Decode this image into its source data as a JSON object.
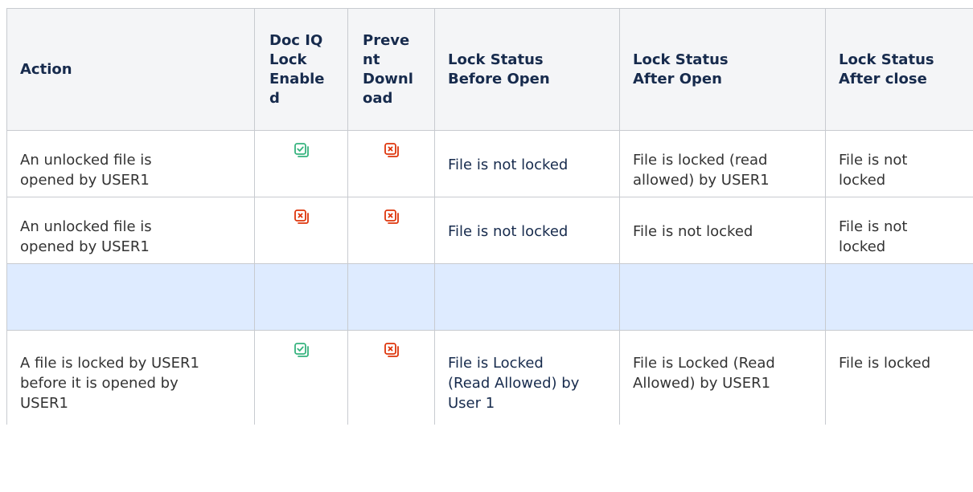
{
  "table": {
    "headers": {
      "action": "Action",
      "doc_iq_lock_enabled": "Doc IQ\nLock\nEnable\nd",
      "prevent_download": "Preve\nnt\nDownl\noad",
      "lock_before_open": "Lock Status\nBefore Open",
      "lock_after_open": "Lock Status\nAfter Open",
      "lock_after_close": "Lock Status\nAfter close"
    },
    "rows": [
      {
        "action": "An unlocked file is\nopened by USER1",
        "doc_iq_lock_enabled": "check-icon",
        "prevent_download": "cross-icon",
        "lock_before_open": "File is not locked",
        "lock_after_open": "File is locked (read\nallowed) by USER1",
        "lock_after_close": "File is not\nlocked"
      },
      {
        "action": "An unlocked file is\nopened by USER1",
        "doc_iq_lock_enabled": "cross-icon",
        "prevent_download": "cross-icon",
        "lock_before_open": "File is not locked",
        "lock_after_open": "File is not locked",
        "lock_after_close": "File is not\nlocked"
      },
      {
        "action": "",
        "doc_iq_lock_enabled": "",
        "prevent_download": "",
        "lock_before_open": "",
        "lock_after_open": "",
        "lock_after_close": ""
      },
      {
        "action": "A file is locked by USER1\nbefore it is opened by\nUSER1",
        "doc_iq_lock_enabled": "check-icon",
        "prevent_download": "cross-icon",
        "lock_before_open": "File is Locked\n(Read Allowed) by\nUser 1",
        "lock_after_open": "File is Locked (Read\nAllowed) by USER1",
        "lock_after_close": "File is locked"
      }
    ]
  },
  "colors": {
    "check": "#36b37e",
    "cross": "#de350b",
    "header_bg": "#f4f5f7",
    "highlight_row_bg": "#deebff",
    "border": "#c8cbd0"
  }
}
